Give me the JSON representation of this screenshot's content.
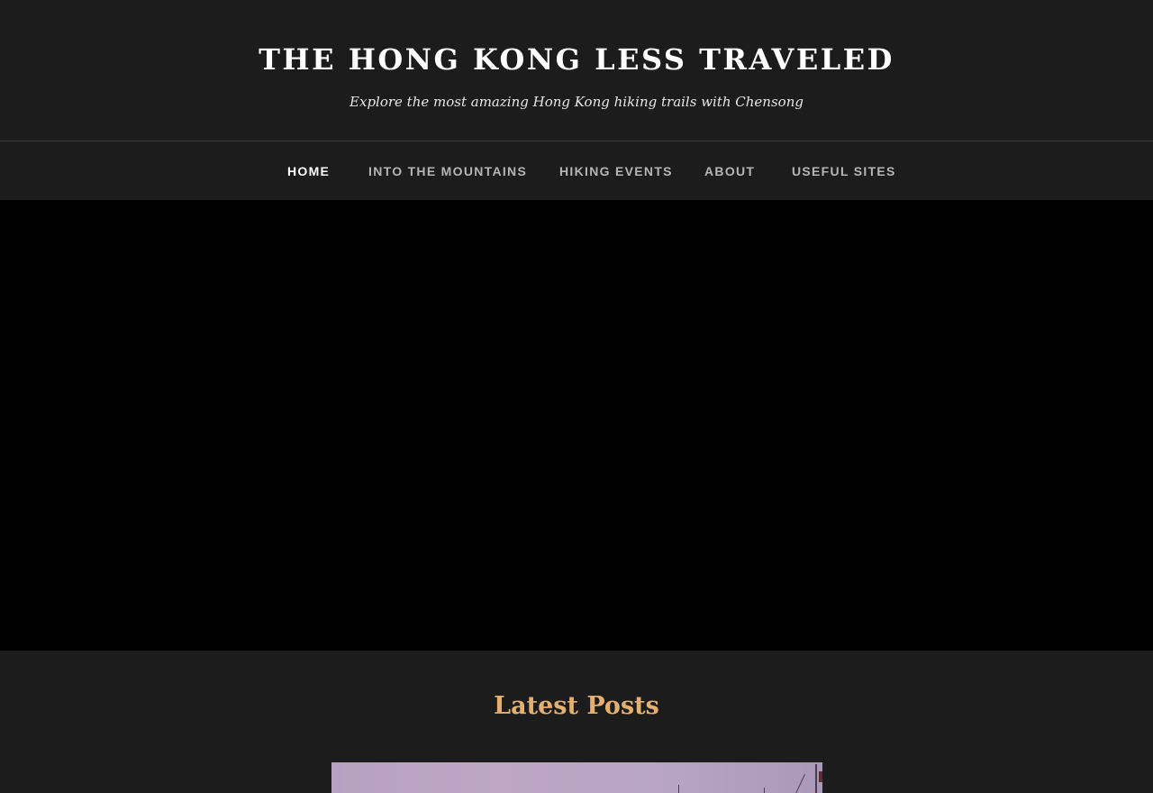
{
  "site": {
    "title": "THE HONG KONG LESS TRAVELED",
    "tagline": "Explore the most amazing Hong Kong hiking trails with Chensong"
  },
  "nav": {
    "items": [
      {
        "label": "HOME",
        "active": true
      },
      {
        "label": "INTO THE MOUNTAINS",
        "active": false
      },
      {
        "label": "HIKING EVENTS",
        "active": false
      },
      {
        "label": "ABOUT",
        "active": false
      },
      {
        "label": "USEFUL SITES",
        "active": false
      }
    ]
  },
  "latest": {
    "heading": "Latest Posts"
  },
  "colors": {
    "background": "#1c1c1c",
    "hero": "#000000",
    "accent": "#e3b071",
    "nav_text": "#b5b5b5",
    "nav_active": "#ffffff"
  }
}
